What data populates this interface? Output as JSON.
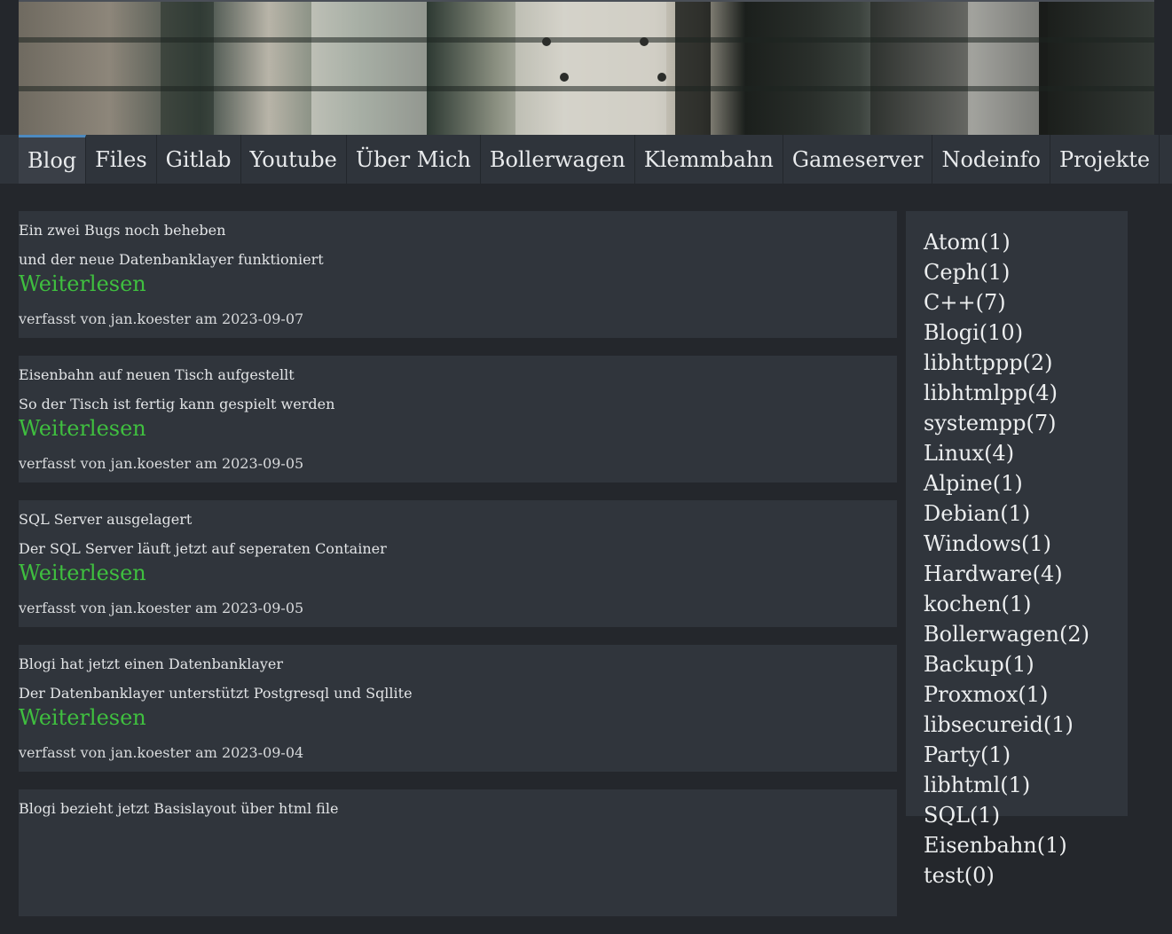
{
  "nav": {
    "items": [
      "Blog",
      "Files",
      "Gitlab",
      "Youtube",
      "Über Mich",
      "Bollerwagen",
      "Klemmbahn",
      "Gameserver",
      "Nodeinfo",
      "Projekte"
    ],
    "active": "Blog"
  },
  "posts": [
    {
      "title": "Ein zwei Bugs noch beheben",
      "teaser": "und der neue Datenbanklayer funktioniert",
      "more": "Weiterlesen",
      "meta": "verfasst von jan.koester am 2023-09-07"
    },
    {
      "title": "Eisenbahn auf neuen Tisch aufgestellt",
      "teaser": "So der Tisch ist fertig kann gespielt werden",
      "more": "Weiterlesen",
      "meta": "verfasst von jan.koester am 2023-09-05"
    },
    {
      "title": "SQL Server ausgelagert",
      "teaser": "Der SQL Server läuft jetzt auf seperaten Container",
      "more": "Weiterlesen",
      "meta": "verfasst von jan.koester am 2023-09-05"
    },
    {
      "title": "Blogi hat jetzt einen Datenbanklayer",
      "teaser": "Der Datenbanklayer unterstützt Postgresql und Sqllite",
      "more": "Weiterlesen",
      "meta": "verfasst von jan.koester am 2023-09-04"
    },
    {
      "title": "Blogi bezieht jetzt Basislayout über html file",
      "teaser": "",
      "more": "",
      "meta": ""
    }
  ],
  "tags": [
    "Atom(1)",
    "Ceph(1)",
    "C++(7)",
    "Blogi(10)",
    "libhttppp(2)",
    "libhtmlpp(4)",
    "systempp(7)",
    "Linux(4)",
    "Alpine(1)",
    "Debian(1)",
    "Windows(1)",
    "Hardware(4)",
    "kochen(1)",
    "Bollerwagen(2)",
    "Backup(1)",
    "Proxmox(1)",
    "libsecureid(1)",
    "Party(1)",
    "libhtml(1)",
    "SQL(1)",
    "Eisenbahn(1)",
    "test(0)"
  ],
  "colors": {
    "link_green": "#3fbf3f",
    "nav_active_border": "#4d8ac0"
  }
}
